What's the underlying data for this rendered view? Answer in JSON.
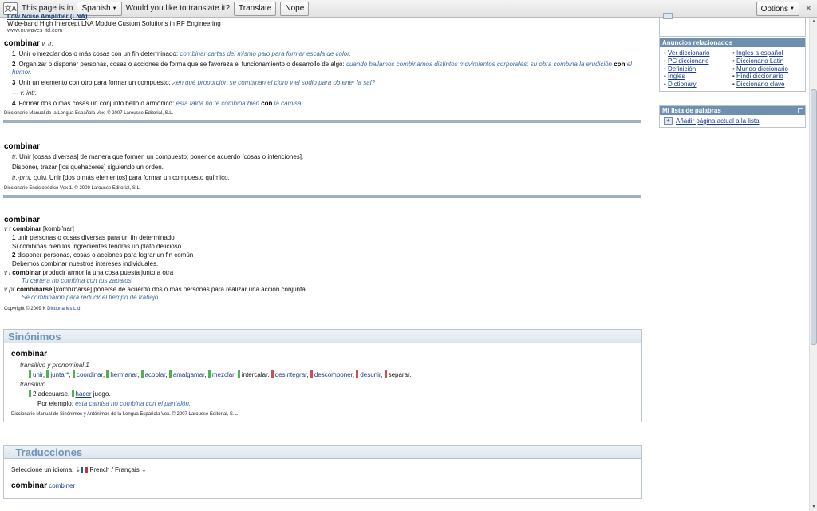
{
  "translate_bar": {
    "prefix": "This page is in",
    "language": "Spanish",
    "question": "Would you like to translate it?",
    "translate_btn": "Translate",
    "nope_btn": "Nope",
    "options_btn": "Options"
  },
  "ad": {
    "title": "Low Noise Amplifier (LNA)",
    "desc": "Wide-band High Intercept LNA Module Custom Solutions in RF Engineering",
    "url": "www.nuwaves-ltd.com"
  },
  "vox": {
    "headword": "combinar",
    "gram": "v. tr.",
    "defs": [
      {
        "n": "1",
        "text": "Unir o mezclar dos o más cosas con un fin determinado:",
        "ex": "combinar cartas del mismo palo para formar escala de color."
      },
      {
        "n": "2",
        "text": "Organizar o disponer personas, cosas o acciones de forma que se favoreza el funcionamiento o desarrollo de algo:",
        "ex": "cuando bailamos combinamos distintos movimientos corporales; su obra combina la erudición",
        "ex_bold": "con",
        "ex_tail": "el humor."
      },
      {
        "n": "3",
        "text": "Unir un elemento con otro para formar un compuesto:",
        "ex": "¿en qué proporción se combinan el cloro y el sodio para obtener la sal?"
      },
      {
        "n": "4",
        "text": "Formar dos o más cosas un conjunto bello o armónico:",
        "ex": "esta falda no te combina bien",
        "ex_bold": "con",
        "ex_tail": "la camisa."
      }
    ],
    "intr": "— v. intr.",
    "copyright": "Diccionario Manual de la Lengua Española Vox. © 2007 Larousse Editorial, S.L."
  },
  "enc": {
    "headword": "combinar",
    "l1_gram": "tr.",
    "l1": "Unir [cosas diversas] de manera que formen un compuesto; poner de acuerdo [cosas o intenciones].",
    "l2": "Disponer, trazar [los quehaceres] siguiendo un orden.",
    "l3_gram": "tr.-prnl.",
    "l3_tag": "QUÍM.",
    "l3": "Unir [dos o más elementos] para formar un compuesto químico.",
    "copyright": "Diccionario Enciclopédico Vox 1. © 2009 Larousse Editorial, S.L."
  },
  "kd": {
    "headword": "combinar",
    "l1_gram": "v t",
    "l1_word": "combinar",
    "l1_pron": "[kombi'nar]",
    "d1_n": "1",
    "d1": "unir personas o cosas diversas para un fin determinado",
    "d1_ex": "Si combinas bien los ingredientes tendrás un plato delicioso.",
    "d2_n": "2",
    "d2": "disponer personas, cosas o acciones para lograr un fin común",
    "d2_ex": "Debemos combinar nuestros intereses individuales.",
    "vi_gram": "v i",
    "vi_word": "combinar",
    "vi": "producir armonía una cosa puesta junto a otra",
    "vi_ex": "Tu cartera no combina con tus zapatos.",
    "vpr_gram": "v pr",
    "vpr_word": "combinarse",
    "vpr_pron": "[kombi'narse]",
    "vpr": "ponerse de acuerdo dos o más personas para realizar una acción conjunta",
    "vpr_ex": "Se combinaron para reducir el tiempo de trabajo.",
    "copyright_prefix": "Copyright © 2009",
    "copyright_link": "K Dictionaries Ltd."
  },
  "synonyms": {
    "header": "Sinónimos",
    "headword": "combinar",
    "gram1": "transitivo y pronominal 1",
    "row1_green": [
      "unir",
      "juntar*",
      "coordinar",
      "hermanar",
      "acoplar",
      "amalgamar",
      "mezclar"
    ],
    "row1_plain": "intercalar.",
    "row1_red": [
      "desintegrar",
      "descomponer",
      "desunir"
    ],
    "row1_end": "separar.",
    "gram2": "transitivo",
    "row2_prefix": "2 adecuarse,",
    "row2_link": "hacer",
    "row2_end": "juego.",
    "example_label": "Por ejemplo:",
    "example": "esta camisa no combina con el pantalón.",
    "copyright": "Diccionario Manual de Sinónimos y Antónimos de la Lengua Española Vox. © 2007 Larousse Editorial, S.L."
  },
  "translations": {
    "header": "Traducciones",
    "toggle": "-",
    "select_label": "Seleccione un idioma:",
    "language": "French / Français",
    "headword": "combinar",
    "translation": "combiner"
  },
  "related_ads": {
    "header": "Anuncios relacionados",
    "left": [
      "Ver diccionario",
      "PC diccionario",
      "Definición",
      "Ingles",
      "Dictionary"
    ],
    "right": [
      "Ingles a español",
      "Diccionario Latin",
      "Mundo diccionario",
      "Hindi diccionario",
      "Diccionario clave"
    ]
  },
  "word_list": {
    "header": "Mi lista de palabras",
    "add": "Añadir página actual a la lista"
  },
  "colors": {
    "header_blue": "#6f94b6",
    "link": "#1a3a8a",
    "example": "#3b6aa8",
    "syn_green": "#4fb34f",
    "ant_red": "#d05050"
  }
}
